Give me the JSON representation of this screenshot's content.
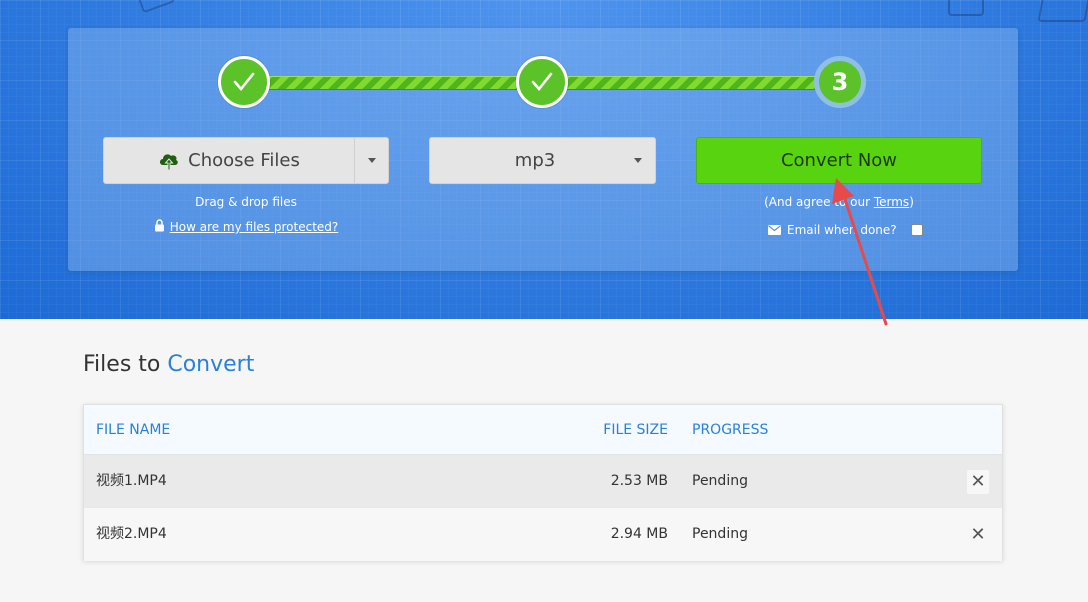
{
  "steps": [
    {
      "state": "done",
      "icon": "check-icon"
    },
    {
      "state": "done",
      "icon": "check-icon"
    },
    {
      "state": "current",
      "number": "3"
    }
  ],
  "upload": {
    "choose_label": "Choose Files",
    "icon": "cloud-upload-icon",
    "drag_hint": "Drag & drop files",
    "protected_link": "How are my files protected?"
  },
  "format": {
    "selected": "mp3"
  },
  "convert": {
    "button_label": "Convert Now",
    "agree_prefix": "(And agree to our ",
    "terms_link": "Terms",
    "agree_suffix": ")",
    "email_label": "Email when done?"
  },
  "files": {
    "title_prefix": "Files to",
    "title_accent": "Convert",
    "columns": {
      "name": "FILE NAME",
      "size": "FILE SIZE",
      "progress": "PROGRESS"
    },
    "rows": [
      {
        "name": "视频1.MP4",
        "size": "2.53 MB",
        "progress": "Pending"
      },
      {
        "name": "视频2.MP4",
        "size": "2.94 MB",
        "progress": "Pending"
      }
    ]
  },
  "colors": {
    "accent_blue": "#2a80dc",
    "green": "#57d40f",
    "annotation_arrow": "#e84a4a"
  }
}
